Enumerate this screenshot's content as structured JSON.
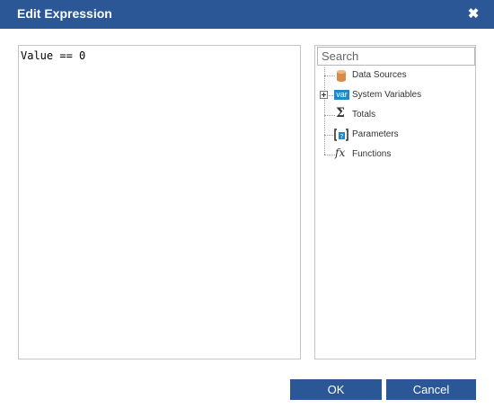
{
  "dialog": {
    "title": "Edit Expression",
    "close_glyph": "✖"
  },
  "editor": {
    "expression": "Value == 0"
  },
  "tree": {
    "search_placeholder": "Search",
    "items": [
      {
        "label": "Data Sources",
        "icon": "database-icon",
        "expandable": false
      },
      {
        "label": "System Variables",
        "icon": "var-icon",
        "badge": "var",
        "expandable": true
      },
      {
        "label": "Totals",
        "icon": "sigma-icon",
        "glyph": "Σ",
        "expandable": false
      },
      {
        "label": "Parameters",
        "icon": "parameters-icon",
        "expandable": false
      },
      {
        "label": "Functions",
        "icon": "function-icon",
        "glyph": "fx",
        "expandable": false
      }
    ]
  },
  "buttons": {
    "ok": "OK",
    "cancel": "Cancel"
  },
  "colors": {
    "accent": "#2b5797",
    "var_badge": "#1e88c9",
    "database": "#d98b4b"
  }
}
